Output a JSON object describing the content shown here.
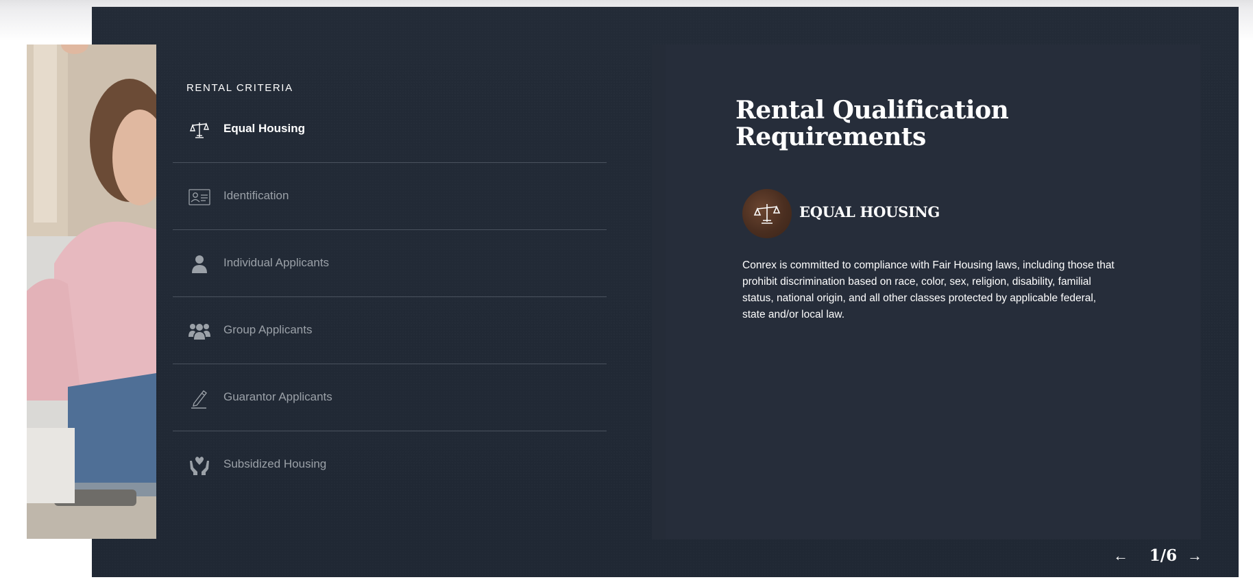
{
  "criteria": {
    "heading": "RENTAL CRITERIA",
    "items": [
      {
        "label": "Equal Housing",
        "icon": "scales-icon",
        "active": true
      },
      {
        "label": "Identification",
        "icon": "id-card-icon",
        "active": false
      },
      {
        "label": "Individual Applicants",
        "icon": "person-icon",
        "active": false
      },
      {
        "label": "Group Applicants",
        "icon": "group-icon",
        "active": false
      },
      {
        "label": "Guarantor Applicants",
        "icon": "pencil-icon",
        "active": false
      },
      {
        "label": "Subsidized Housing",
        "icon": "hands-heart-icon",
        "active": false
      }
    ]
  },
  "detail": {
    "title": "Rental Qualification Requirements",
    "section_title": "EQUAL HOUSING",
    "section_icon": "scales-icon",
    "body": "Conrex is committed to compliance with Fair Housing laws, including those that prohibit discrimination based on race, color, sex, religion, disability, familial status, national origin, and all other classes protected by applicable federal, state and/or local law."
  },
  "pager": {
    "prev_icon": "arrow-left-icon",
    "next_icon": "arrow-right-icon",
    "count": "1/6"
  },
  "colors": {
    "panel_bg": "#222a36",
    "detail_bg": "#262d3a",
    "divider": "#4a525e",
    "inactive_text": "#9ba1a8",
    "active_text": "#ffffff",
    "badge_bg": "#5a3a28"
  }
}
